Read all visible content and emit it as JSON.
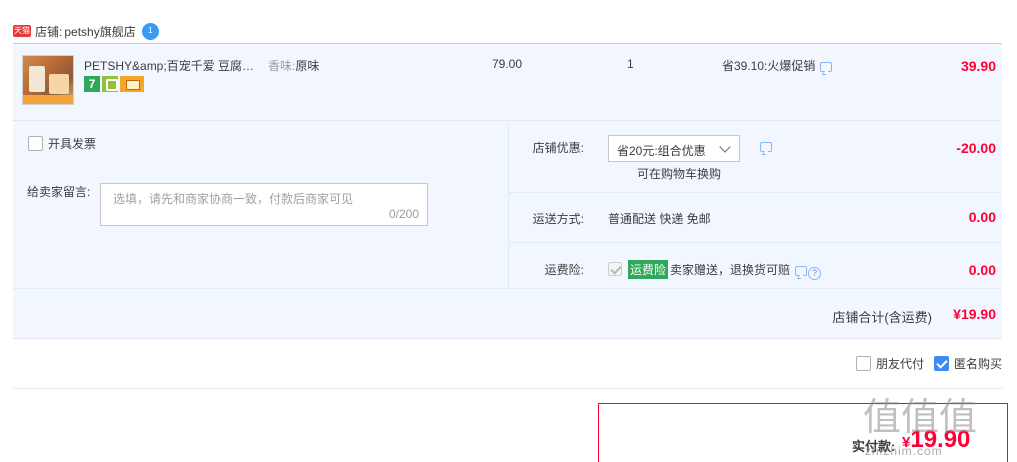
{
  "shop": {
    "badge": "天猫",
    "prefix": "店铺:",
    "name": "petshy旗舰店",
    "ww_badge": "1"
  },
  "item": {
    "title": "PETSHY&amp;百宠千爱 豆腐猫砂",
    "sku_label": "香味:",
    "sku_value": "原味",
    "tag_seven": "7",
    "unit_price": "79.00",
    "quantity": "1",
    "promo": "省39.10:火爆促销",
    "subtotal": "39.90"
  },
  "invoice": {
    "label": "开具发票",
    "checked": false
  },
  "message": {
    "label": "给卖家留言:",
    "placeholder": "选填，请先和商家协商一致，付款后商家可见",
    "counter": "0/200"
  },
  "discount": {
    "label": "店铺优惠:",
    "selected": "省20元:组合优惠",
    "hint": "可在购物车换购",
    "amount": "-20.00"
  },
  "shipping": {
    "label": "运送方式:",
    "value": "普通配送 快递 免邮",
    "amount": "0.00"
  },
  "insurance": {
    "label": "运费险:",
    "badge": "运费险",
    "text": "卖家赠送，退换货可赔",
    "help": "?",
    "amount": "0.00"
  },
  "shop_total": {
    "label": "店铺合计(含运费)",
    "amount": "¥19.90"
  },
  "extras": {
    "friend_pay": {
      "label": "朋友代付",
      "checked": false
    },
    "anonymous": {
      "label": "匿名购买",
      "checked": true
    }
  },
  "payment": {
    "label": "实付款:",
    "currency": "¥",
    "amount": "19.90"
  },
  "watermark": {
    "glyphs": "值值值",
    "url": "zhizhim.com"
  },
  "colors": {
    "price_red": "#ff0036",
    "accent_blue": "#3b8cf0",
    "row_bg": "#f2f7ff",
    "tag_green": "#2fa85b"
  }
}
